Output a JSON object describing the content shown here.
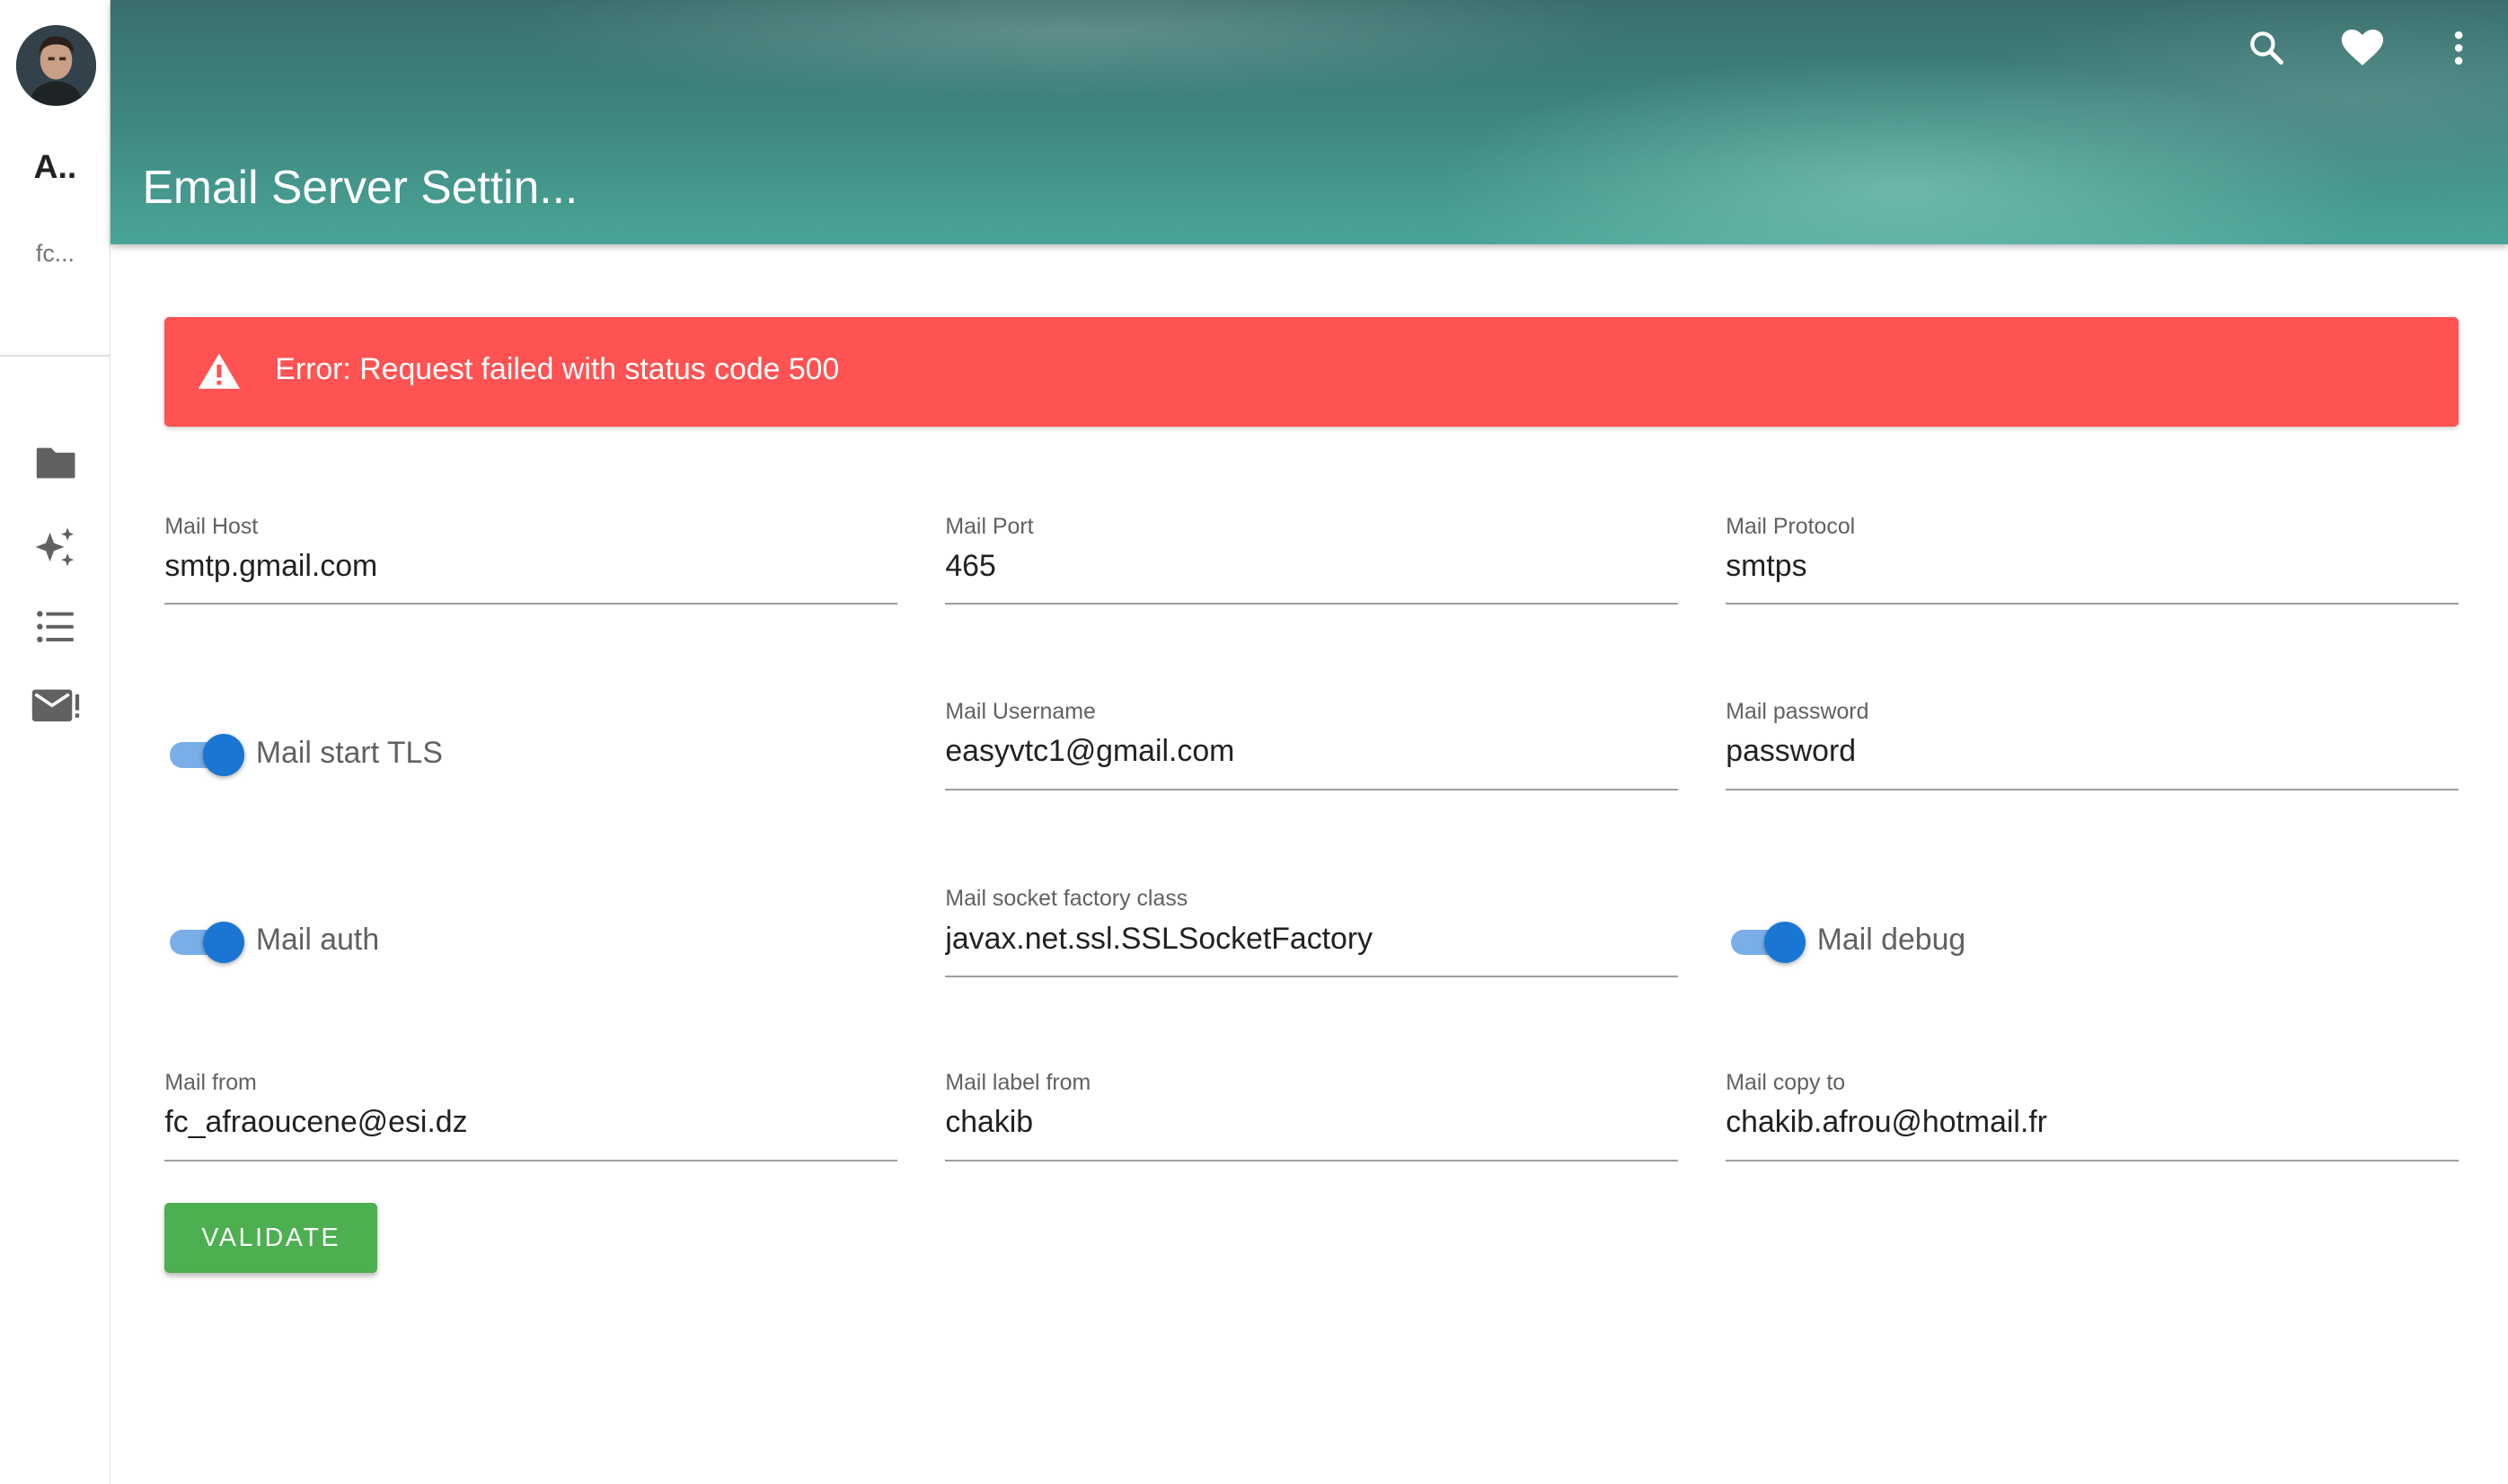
{
  "sidebar": {
    "title": "A..",
    "subtitle": "fc...",
    "icons": [
      "folder-icon",
      "sparkles-icon",
      "list-icon",
      "mail-alert-icon"
    ]
  },
  "header": {
    "title": "Email Server Settin...",
    "icons": [
      "search-icon",
      "heart-icon",
      "more-vert-icon"
    ]
  },
  "alert": {
    "message": "Error: Request failed with status code 500",
    "color": "#ff5252"
  },
  "form": {
    "mail_host": {
      "label": "Mail Host",
      "value": "smtp.gmail.com"
    },
    "mail_port": {
      "label": "Mail Port",
      "value": "465"
    },
    "mail_protocol": {
      "label": "Mail Protocol",
      "value": "smtps"
    },
    "mail_start_tls": {
      "label": "Mail start TLS",
      "checked": true
    },
    "mail_username": {
      "label": "Mail Username",
      "value": "easyvtc1@gmail.com"
    },
    "mail_password": {
      "label": "Mail password",
      "value": "password"
    },
    "mail_auth": {
      "label": "Mail auth",
      "checked": true
    },
    "mail_socket_factory_class": {
      "label": "Mail socket factory class",
      "value": "javax.net.ssl.SSLSocketFactory"
    },
    "mail_debug": {
      "label": "Mail debug",
      "checked": true
    },
    "mail_from": {
      "label": "Mail from",
      "value": "fc_afraoucene@esi.dz"
    },
    "mail_label_from": {
      "label": "Mail label from",
      "value": "chakib"
    },
    "mail_copy_to": {
      "label": "Mail copy to",
      "value": "chakib.afrou@hotmail.fr"
    },
    "validate_label": "VALIDATE"
  },
  "colors": {
    "accent": "#1976d2",
    "button": "#4caf50",
    "header": "#3f8a82"
  }
}
